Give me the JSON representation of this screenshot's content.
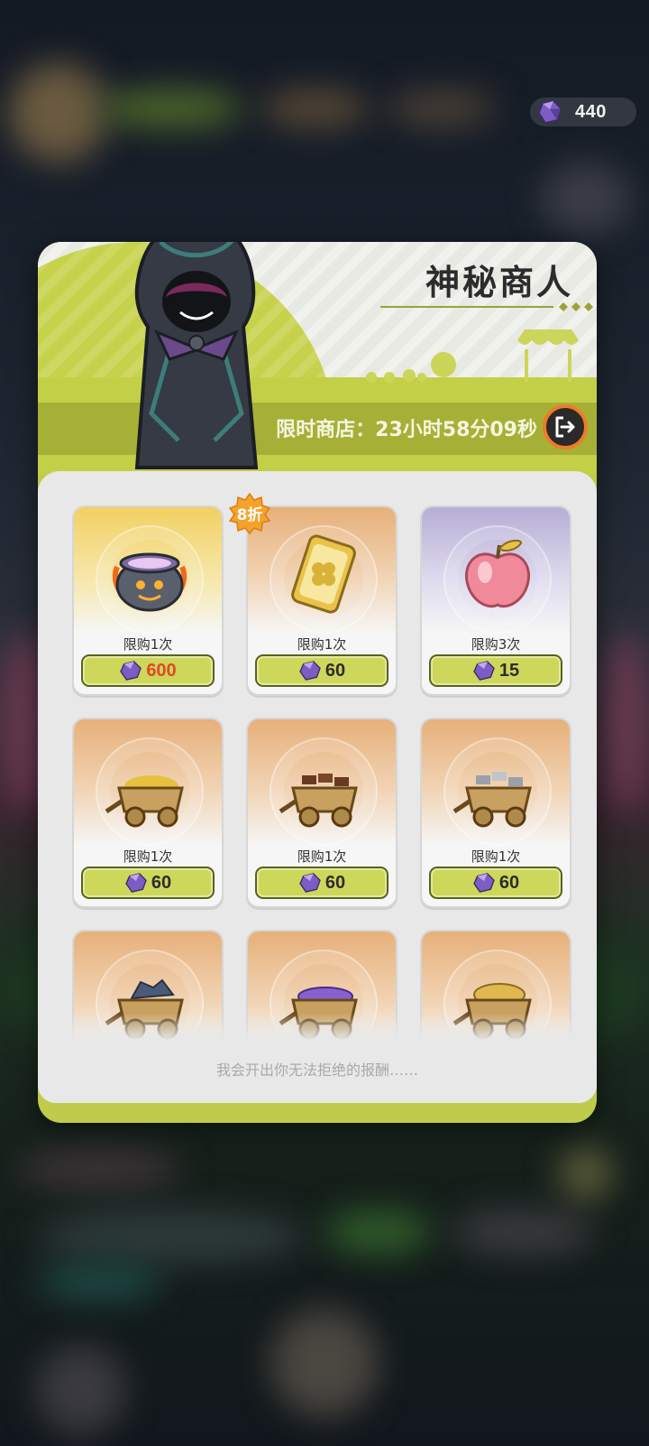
{
  "currency": {
    "icon": "purple-gem-icon",
    "amount": "440"
  },
  "shop": {
    "title": "神秘商人",
    "timer": "限时商店：23小时58分09秒",
    "discount_badge": "8折",
    "footer": "我会开出你无法拒绝的报酬……",
    "items": [
      {
        "name": "cauldron",
        "icon": "cauldron-icon",
        "limit": "限购1次",
        "price": "600",
        "price_color": "#e2472a",
        "bg": "gold"
      },
      {
        "name": "clover-ticket",
        "icon": "clover-ticket-icon",
        "limit": "限购1次",
        "price": "60",
        "bg": "orange"
      },
      {
        "name": "apple",
        "icon": "pink-apple-icon",
        "limit": "限购3次",
        "price": "15",
        "bg": "purple"
      },
      {
        "name": "gold-cart",
        "icon": "gold-cart-icon",
        "limit": "限购1次",
        "price": "60",
        "bg": "orange"
      },
      {
        "name": "wood-cart",
        "icon": "wood-cart-icon",
        "limit": "限购1次",
        "price": "60",
        "bg": "orange"
      },
      {
        "name": "iron-cart",
        "icon": "iron-cart-icon",
        "limit": "限购1次",
        "price": "60",
        "bg": "orange"
      },
      {
        "name": "ore-cart",
        "icon": "ore-cart-icon",
        "bg": "orange"
      },
      {
        "name": "crystal-cart",
        "icon": "crystal-cart-icon",
        "bg": "orange"
      },
      {
        "name": "grain-cart",
        "icon": "grain-cart-icon",
        "bg": "orange"
      }
    ]
  },
  "colors": {
    "accent": "#bfcb4a",
    "button": "#cdd75a",
    "exit_ring": "#f07a2a"
  }
}
